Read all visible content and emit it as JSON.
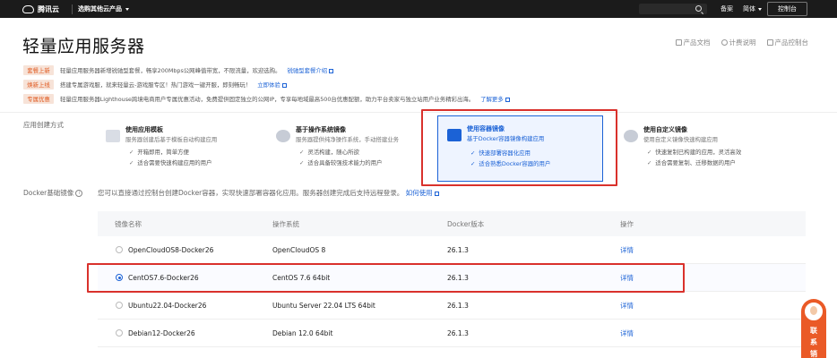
{
  "topbar": {
    "logo_text": "腾讯云",
    "product_menu": "选购其他云产品",
    "links": [
      "备案",
      "控制台"
    ],
    "lang": "简体",
    "console_button": "控制台"
  },
  "title": "轻量应用服务器",
  "title_links": [
    "产品文档",
    "计费说明",
    "产品控制台"
  ],
  "promos": [
    {
      "tag": "套餐上新",
      "text": "轻量应用服务器新增锐驰型套餐，畅享200Mbps公网峰值带宽，不限流量，欢迎选购。",
      "link": "锐驰型套餐介绍"
    },
    {
      "tag": "焕新上线",
      "text": "搭建专属游戏服，就来轻量云-游戏服专区！热门游戏一键开服，即刻畅玩！",
      "link": "立即体验"
    },
    {
      "tag": "专属优惠",
      "text": "轻量应用服务器Lighthouse跨境电商用户专属优惠活动，免费提供固定独立的公网IP，专享每地域最高500台优惠配额，助力平台卖家与独立站用户业务精彩出海。",
      "link": "了解更多"
    }
  ],
  "creation": {
    "label": "应用创建方式",
    "cards": [
      {
        "title": "使用应用模板",
        "desc": "服务器创建后基于模板自动构建应用",
        "features": [
          "开箱即用，简单方便",
          "适合需要快速构建应用的用户"
        ]
      },
      {
        "title": "基于操作系统镜像",
        "desc": "服务器提供纯净操作系统，手动搭建业务",
        "features": [
          "灵活构建，随心所欲",
          "适合具备较强技术能力的用户"
        ]
      },
      {
        "title": "使用容器镜像",
        "desc": "基于Docker容器镜像构建应用",
        "features": [
          "快速部署容器化应用",
          "适合熟悉Docker容器的用户"
        ]
      },
      {
        "title": "使用自定义镜像",
        "desc": "使用自定义镜像快速构建应用",
        "features": [
          "快速复制已构建的应用，灵活高效",
          "适合需要复制、迁移数据的用户"
        ]
      }
    ]
  },
  "docker": {
    "label": "Docker基础镜像",
    "desc": "您可以直接通过控制台创建Docker容器，实现快速部署容器化应用。服务器创建完成后支持远程登录。",
    "link": "如何使用"
  },
  "table": {
    "headers": [
      "镜像名称",
      "操作系统",
      "Docker版本",
      "操作"
    ],
    "rows": [
      {
        "name": "OpenCloudOS8-Docker26",
        "os": "OpenCloudOS 8",
        "version": "26.1.3",
        "action": "详情",
        "selected": false
      },
      {
        "name": "CentOS7.6-Docker26",
        "os": "CentOS 7.6 64bit",
        "version": "26.1.3",
        "action": "详情",
        "selected": true
      },
      {
        "name": "Ubuntu22.04-Docker26",
        "os": "Ubuntu Server 22.04 LTS 64bit",
        "version": "26.1.3",
        "action": "详情",
        "selected": false
      },
      {
        "name": "Debian12-Docker26",
        "os": "Debian 12.0 64bit",
        "version": "26.1.3",
        "action": "详情",
        "selected": false
      }
    ]
  },
  "contact": [
    "联",
    "系",
    "销"
  ],
  "colors": {
    "accent": "#1b62d6",
    "highlight_box": "#d9312c",
    "promo_tag": "#e05a21",
    "topbar": "#1b1b1b",
    "contact": "#ea5a27"
  }
}
